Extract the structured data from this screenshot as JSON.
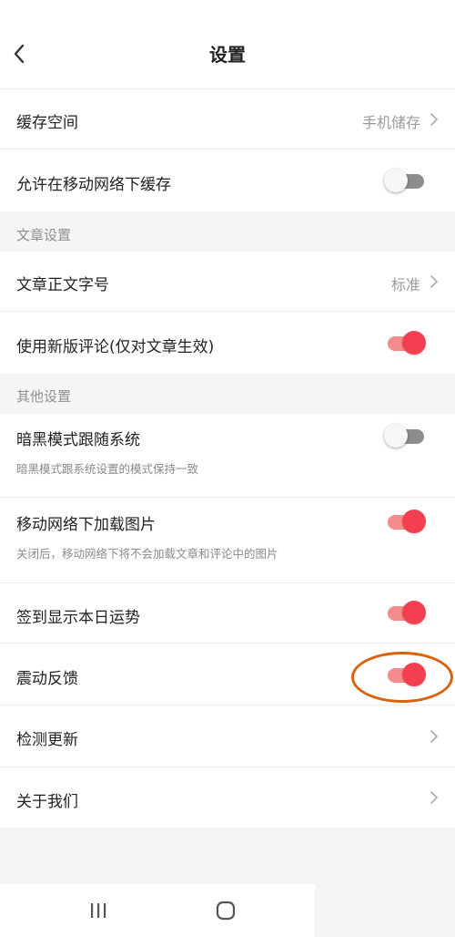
{
  "header": {
    "title": "设置"
  },
  "rows": {
    "cache_space": {
      "label": "缓存空间",
      "value": "手机储存"
    },
    "allow_mobile_cache": {
      "label": "允许在移动网络下缓存",
      "enabled": false
    },
    "font_size": {
      "label": "文章正文字号",
      "value": "标准"
    },
    "new_comments": {
      "label": "使用新版评论(仅对文章生效)",
      "enabled": true
    },
    "dark_mode": {
      "label": "暗黑模式跟随系统",
      "description": "暗黑模式跟系统设置的模式保持一致",
      "enabled": false
    },
    "mobile_images": {
      "label": "移动网络下加载图片",
      "description": "关闭后，移动网络下将不会加载文章和评论中的图片",
      "enabled": true
    },
    "daily_fortune": {
      "label": "签到显示本日运势",
      "enabled": true
    },
    "vibration": {
      "label": "震动反馈",
      "enabled": true
    },
    "check_update": {
      "label": "检测更新"
    },
    "about_us": {
      "label": "关于我们"
    }
  },
  "sections": {
    "article": "文章设置",
    "other": "其他设置"
  },
  "colors": {
    "accent": "#f43f51",
    "accent_track": "#f58b8c",
    "annotation": "#d9620b"
  },
  "icons": {
    "back": "chevron-left-icon",
    "forward": "chevron-right-icon",
    "recents": "recent-apps-icon",
    "home": "home-icon"
  }
}
